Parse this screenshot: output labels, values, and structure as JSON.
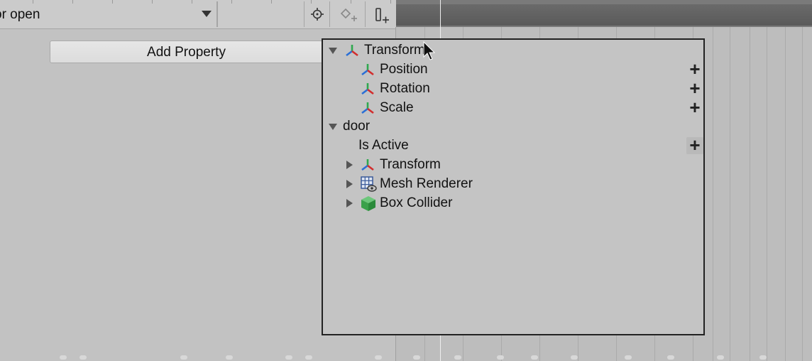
{
  "toolbar": {
    "clip_name": "or open",
    "icons": [
      "keyframe-target-icon",
      "add-keyframe-icon",
      "add-event-icon"
    ]
  },
  "add_property_button": {
    "label": "Add Property"
  },
  "popup": {
    "groups": [
      {
        "label": "Transform",
        "expanded": true,
        "icon": "transform-icon",
        "items": [
          {
            "label": "Position",
            "icon": "transform-icon"
          },
          {
            "label": "Rotation",
            "icon": "transform-icon"
          },
          {
            "label": "Scale",
            "icon": "transform-icon"
          }
        ]
      },
      {
        "label": "door",
        "expanded": true,
        "items": [
          {
            "label": "Is Active"
          },
          {
            "label": "Transform",
            "icon": "transform-icon",
            "collapsed": true
          },
          {
            "label": "Mesh Renderer",
            "icon": "mesh-renderer-icon",
            "collapsed": true
          },
          {
            "label": "Box Collider",
            "icon": "box-collider-icon",
            "collapsed": true
          }
        ]
      }
    ]
  },
  "colors": {
    "background": "#c2c2c2",
    "popup_background": "#c4c4c4",
    "popup_border": "#222222",
    "timeline_header": "#6a6a6a",
    "axis_x_red": "#d22d2d",
    "axis_y_green": "#2fa84f",
    "axis_z_blue": "#2a6fd6",
    "box_collider_green": "#3aa14a"
  }
}
